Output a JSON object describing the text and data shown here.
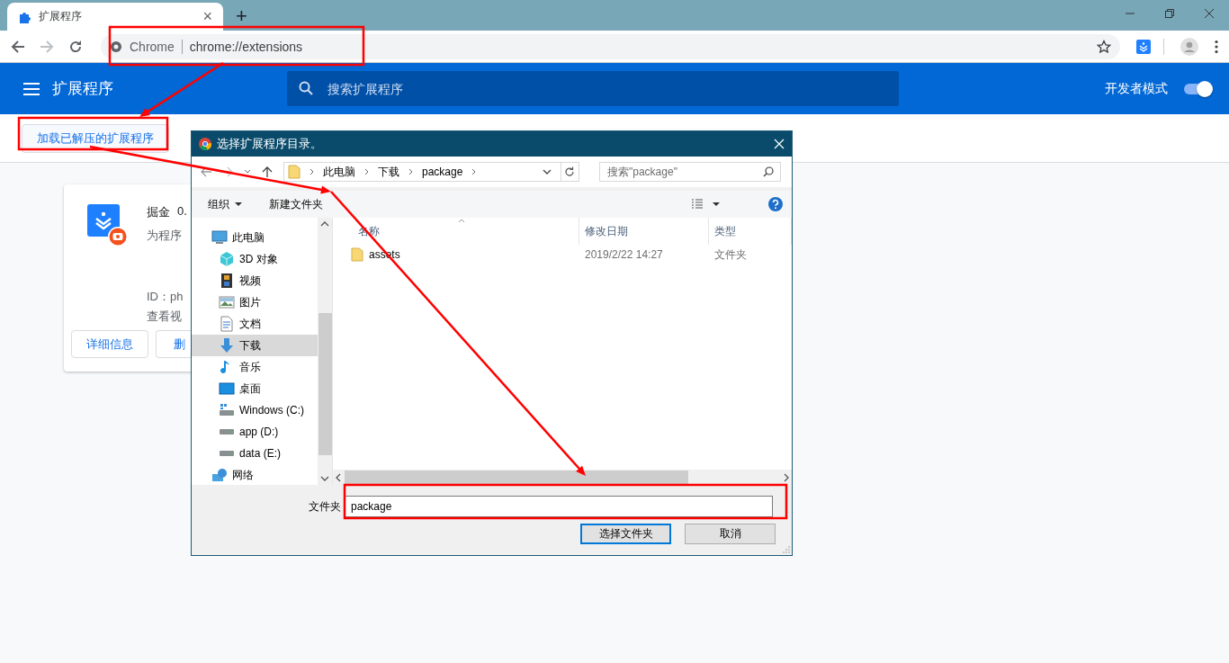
{
  "browser": {
    "tab": {
      "title": "扩展程序",
      "close": "×",
      "selected": true
    },
    "new_tab": "+",
    "address": {
      "site": "Chrome",
      "url": "chrome://extensions"
    }
  },
  "header": {
    "title": "扩展程序",
    "search_placeholder": "搜索扩展程序",
    "developer_mode": {
      "label": "开发者模式",
      "on": true
    }
  },
  "toolbar": {
    "buttons": [
      "加载已解压的扩展程序"
    ]
  },
  "extension_card": {
    "name": "掘金",
    "version": "0.",
    "description": "为程序",
    "id": "ID：ph",
    "link": "查看视",
    "buttons": [
      "详细信息",
      "删"
    ]
  },
  "dialog": {
    "title": "选择扩展程序目录。",
    "breadcrumb": [
      "此电脑",
      "下载",
      "package"
    ],
    "search_placeholder": "搜索\"package\"",
    "commands": [
      "组织",
      "新建文件夹"
    ],
    "nav": [
      {
        "label": "此电脑",
        "kind": "computer",
        "selected": false,
        "children": [
          {
            "label": "3D 对象",
            "kind": "cube",
            "selected": false
          },
          {
            "label": "视频",
            "kind": "video",
            "selected": false
          },
          {
            "label": "图片",
            "kind": "picture",
            "selected": false
          },
          {
            "label": "文档",
            "kind": "document",
            "selected": false
          },
          {
            "label": "下载",
            "kind": "download",
            "selected": true
          },
          {
            "label": "音乐",
            "kind": "music",
            "selected": false
          },
          {
            "label": "桌面",
            "kind": "desktop",
            "selected": false
          },
          {
            "label": "Windows (C:)",
            "kind": "system-drive",
            "selected": false
          },
          {
            "label": "app (D:)",
            "kind": "drive",
            "selected": false
          },
          {
            "label": "data (E:)",
            "kind": "drive",
            "selected": false
          }
        ]
      },
      {
        "label": "网络",
        "kind": "network",
        "selected": false
      }
    ],
    "columns": [
      "名称",
      "修改日期",
      "类型"
    ],
    "rows": [
      {
        "name": "assets",
        "modified": "2019/2/22 14:27",
        "type": "文件夹",
        "selected": false
      }
    ],
    "folder_label": "文件夹",
    "folder_value": "package",
    "buttons": [
      {
        "label": "选择文件夹",
        "default": true
      },
      {
        "label": "取消",
        "default": false
      }
    ]
  }
}
